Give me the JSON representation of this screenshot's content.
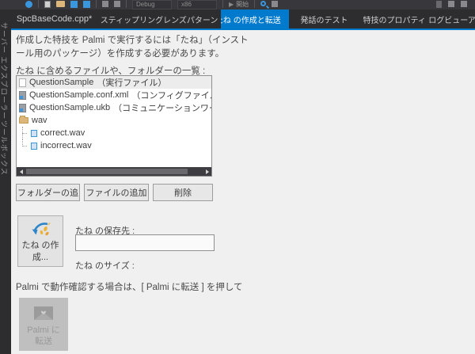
{
  "toolbar": {
    "debug_config": "Debug",
    "platform": "x86",
    "start_label": "開始",
    "icons": [
      "navigate-icon",
      "copy-icon",
      "open-folder-icon",
      "save-icon",
      "save-all-icon",
      "find-icon",
      "bookmark-icon"
    ]
  },
  "tabs": [
    {
      "label": "SpcBaseCode.cpp*",
      "active": false
    },
    {
      "label": "スティップリングレンズパターン",
      "active": false
    },
    {
      "label": "たね の作成と転送",
      "active": true
    },
    {
      "label": "発話のテスト",
      "active": false
    },
    {
      "label": "特技のプロパティ",
      "active": false
    },
    {
      "label": "ログビューア",
      "active": false
    }
  ],
  "side_strip": {
    "server_explorer": "サーバー エクスプローラー",
    "toolbox": "ツールボックス"
  },
  "main": {
    "intro_line1": "作成した特技を Palmi で実行するには「たね」（インスト",
    "intro_line2": "ール用のパッケージ）を作成する必要があります。",
    "list_label": "たね に含めるファイルや、フォルダーの一覧 :",
    "file_list": [
      {
        "name": "QuestionSample",
        "note": "（実行ファイル）",
        "icon": "file-icon",
        "selected": true
      },
      {
        "name": "QuestionSample.conf.xml",
        "note": "（コンフィグファイル）",
        "icon": "config-file-icon",
        "selected": false
      },
      {
        "name": "QuestionSample.ukb",
        "note": "（コミュニケーションワードファ",
        "icon": "config-file-icon",
        "selected": false
      },
      {
        "name": "wav",
        "note": "",
        "icon": "folder-icon",
        "selected": false
      },
      {
        "name": "correct.wav",
        "note": "",
        "icon": "audio-file-icon",
        "selected": false,
        "child": true
      },
      {
        "name": "incorrect.wav",
        "note": "",
        "icon": "audio-file-icon",
        "selected": false,
        "child": true
      }
    ],
    "add_folder_button": "フォルダーの追",
    "add_file_button": "ファイルの追加",
    "delete_button": "削除",
    "create_button": "たね の作成...",
    "save_path_label": "たね の保存先 :",
    "save_path_value": "",
    "size_label": "たね のサイズ :",
    "note": "Palmi で動作確認する場合は、[ Palmi に転送 ] を押して",
    "transfer_button": "Palmi に転送"
  },
  "colors": {
    "accent": "#007acc",
    "chrome": "#2d2d30",
    "content_bg": "#f0f0f0",
    "folder": "#dcb67a",
    "file_blue": "#3a96dd"
  }
}
